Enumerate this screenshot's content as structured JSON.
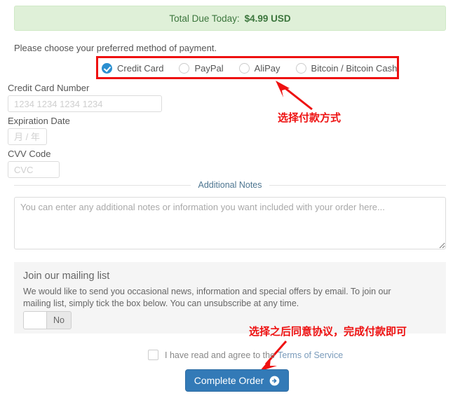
{
  "total": {
    "label": "Total Due Today:",
    "amount": "$4.99 USD",
    "bg_color": "#dff0d8",
    "text_color": "#3c763d"
  },
  "payment": {
    "prompt": "Please choose your preferred method of payment.",
    "selected": "Credit Card",
    "options": [
      {
        "label": "Credit Card",
        "checked": true
      },
      {
        "label": "PayPal",
        "checked": false
      },
      {
        "label": "AliPay",
        "checked": false
      },
      {
        "label": "Bitcoin / Bitcoin Cash",
        "checked": false
      }
    ],
    "highlight_color": "#ee1111",
    "accent_color": "#2a8fd0"
  },
  "card": {
    "number_label": "Credit Card Number",
    "number_value": "",
    "number_placeholder": "1234 1234 1234 1234",
    "expiry_label": "Expiration Date",
    "expiry_value": "",
    "expiry_placeholder": "月 / 年",
    "cvv_label": "CVV Code",
    "cvv_value": "",
    "cvv_placeholder": "CVC"
  },
  "notes": {
    "divider_title": "Additional Notes",
    "value": "",
    "placeholder": "You can enter any additional notes or information you want included with your order here..."
  },
  "mailing_list": {
    "title": "Join our mailing list",
    "description": "We would like to send you occasional news, information and special offers by email. To join our mailing list, simply tick the box below. You can unsubscribe at any time.",
    "toggle_value": "No",
    "panel_bg": "#f5f5f5"
  },
  "terms": {
    "checkbox_checked": false,
    "text": "I have read and agree to the",
    "link": "Terms of Service",
    "link_color": "#7a9bbb"
  },
  "submit": {
    "label": "Complete Order",
    "icon": "arrow-right-circle-icon",
    "color": "#337ab7"
  },
  "annotations": [
    {
      "text": "选择付款方式",
      "color": "#ee1111"
    },
    {
      "text": "选择之后同意协议，完成付款即可",
      "color": "#ee1111"
    }
  ]
}
